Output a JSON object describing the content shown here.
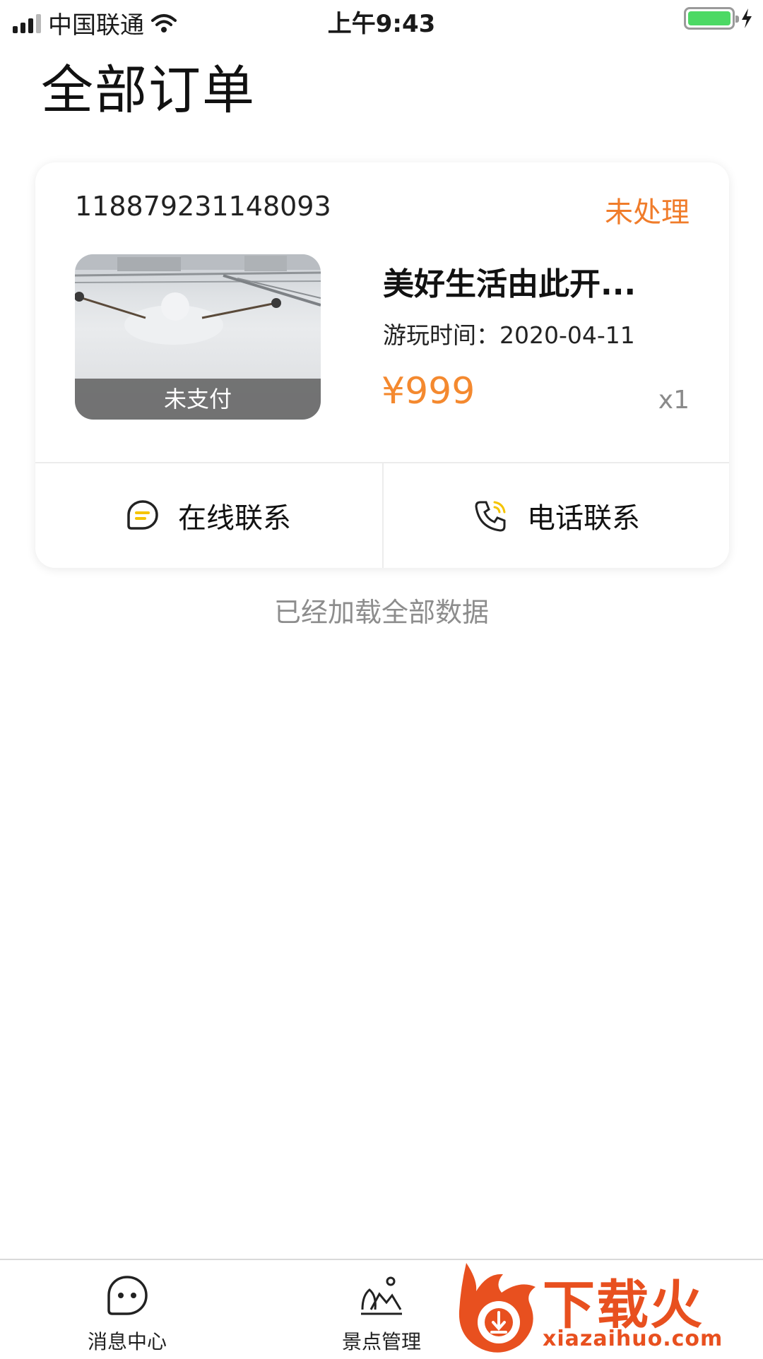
{
  "status_bar": {
    "carrier": "中国联通",
    "time": "上午9:43"
  },
  "page": {
    "title": "全部订单"
  },
  "order": {
    "order_no": "118879231148093",
    "status": "未处理",
    "status_color": "#f07c2a",
    "thumbnail_label": "未支付",
    "product_name": "美好生活由此开...",
    "play_time_label": "游玩时间：",
    "play_time": "2020-04-11",
    "price": "¥999",
    "price_color": "#f4892f",
    "quantity": "x1",
    "actions": {
      "online_contact": "在线联系",
      "phone_contact": "电话联系"
    }
  },
  "list_footer": "已经加载全部数据",
  "tabbar": {
    "items": [
      {
        "label": "消息中心",
        "icon": "chat-bubble-icon"
      },
      {
        "label": "景点管理",
        "icon": "scenic-spot-icon"
      }
    ]
  },
  "watermark": {
    "brand": "下载火",
    "url": "xiazaihuo.com"
  }
}
